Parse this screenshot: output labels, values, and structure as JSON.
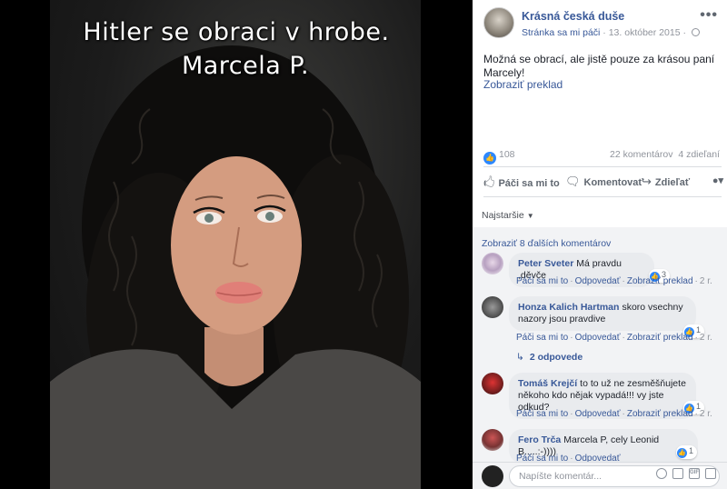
{
  "photo": {
    "caption_line1": "Hitler se obraci v hrobe.",
    "caption_line2": "Marcela P."
  },
  "post": {
    "page_name": "Krásná česká duše",
    "page_type": "Stránka sa mi páči",
    "date": "13. október 2015",
    "text": "Možná se obrací, ale jistě pouze za krásou paní Marcely!",
    "translate": "Zobraziť preklad",
    "likes": "108",
    "comments_count": "22 komentárov",
    "shares_count": "4 zdieľaní"
  },
  "actions": {
    "like": "Páči sa mi to",
    "comment": "Komentovať",
    "share": "Zdieľať"
  },
  "comments_section": {
    "sort_label": "Najstaršie",
    "more_comments": "Zobraziť 8 ďalších komentárov",
    "replies_link": "2 odpovede",
    "composer_placeholder": "Napíšte komentár..."
  },
  "comment_actions": {
    "like": "Páči sa mi to",
    "reply": "Odpovedať",
    "translate": "Zobraziť preklad",
    "time": "2 r."
  },
  "comments": [
    {
      "name": "Peter Sveter",
      "text": "Má pravdu ,děvče",
      "reactions": "3"
    },
    {
      "name": "Honza Kalich Hartman",
      "text": "skoro vsechny nazory jsou pravdive",
      "reactions": "1"
    },
    {
      "name": "Tomáš Krejčí",
      "text": "to to už ne zesměšňujete někoho kdo nějak vypadá!!! vy jste odkud?",
      "reactions": "1"
    },
    {
      "name": "Fero Trča",
      "text": "Marcela P, cely Leonid B.....:-))))",
      "reactions": "1"
    }
  ],
  "colors": {
    "link": "#385898",
    "reaction_blue": "#2d88ff",
    "comment_bubble": "#e9ebee",
    "panel_bg": "#f2f3f5"
  },
  "icons": [
    "more-icon",
    "globe-icon",
    "like-icon",
    "comment-icon",
    "share-icon",
    "emoji-icon",
    "camera-icon",
    "gif-icon",
    "sticker-icon"
  ]
}
